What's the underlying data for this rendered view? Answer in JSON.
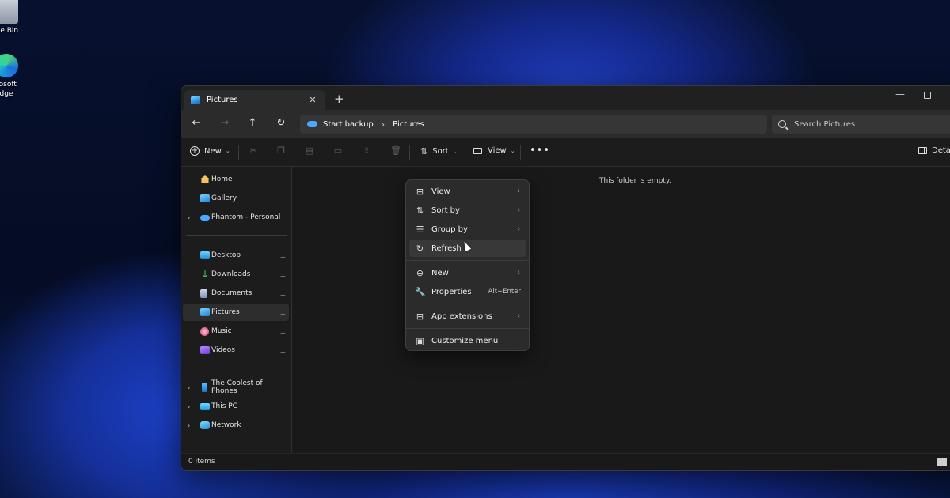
{
  "desktop": {
    "icons": [
      {
        "label": "cle Bin",
        "icon": "recycle-bin-icon"
      },
      {
        "label1": "rosoft",
        "label2": "dge",
        "icon": "edge-icon"
      }
    ]
  },
  "window": {
    "tab": {
      "title": "Pictures",
      "icon": "pictures-folder-icon",
      "close": "✕"
    },
    "new_tab": "+",
    "controls": {
      "minimize": "—"
    }
  },
  "address": {
    "back": "←",
    "forward": "→",
    "up": "↑",
    "refresh": "↻",
    "breadcrumbs": [
      "Start backup",
      "Pictures"
    ],
    "separator": "›"
  },
  "search": {
    "placeholder": "Search Pictures"
  },
  "commands": {
    "new_label": "New",
    "sort_label": "Sort",
    "view_label": "View",
    "more": "•••",
    "details_label": "Details",
    "chevron": "⌄"
  },
  "nav": {
    "items": [
      {
        "label": "Home",
        "icon": "home-icon"
      },
      {
        "label": "Gallery",
        "icon": "gallery-icon"
      },
      {
        "label": "Phantom - Personal",
        "icon": "onedrive-icon"
      },
      {
        "label": "Desktop",
        "icon": "desktop-folder-icon"
      },
      {
        "label": "Downloads",
        "icon": "downloads-folder-icon"
      },
      {
        "label": "Documents",
        "icon": "documents-folder-icon"
      },
      {
        "label": "Pictures",
        "icon": "pictures-folder-icon"
      },
      {
        "label": "Music",
        "icon": "music-folder-icon"
      },
      {
        "label": "Videos",
        "icon": "videos-folder-icon"
      },
      {
        "label": "The Coolest of Phones",
        "icon": "phone-icon"
      },
      {
        "label": "This PC",
        "icon": "this-pc-icon"
      },
      {
        "label": "Network",
        "icon": "network-icon"
      }
    ],
    "expand": "›",
    "pin": "📌"
  },
  "content": {
    "empty_message": "This folder is empty."
  },
  "status": {
    "item_count": "0 items"
  },
  "context_menu": {
    "items": [
      {
        "label": "View",
        "icon": "grid-icon",
        "glyph": "⊞"
      },
      {
        "label": "Sort by",
        "icon": "sort-icon",
        "glyph": "⇅"
      },
      {
        "label": "Group by",
        "icon": "group-icon",
        "glyph": "☰"
      },
      {
        "label": "Refresh",
        "icon": "refresh-icon",
        "glyph": "↻"
      },
      {
        "label": "New",
        "icon": "new-icon",
        "glyph": "⊕"
      },
      {
        "label": "Properties",
        "icon": "wrench-icon",
        "glyph": "🔧",
        "shortcut": "Alt+Enter"
      },
      {
        "label": "App extensions",
        "icon": "extensions-icon",
        "glyph": "⊞"
      },
      {
        "label": "Customize menu",
        "icon": "customize-icon",
        "glyph": "▣"
      }
    ],
    "arrow": "›"
  },
  "colors": {
    "accent": "#4aa8ff",
    "window_bg": "#1c1c1c",
    "menu_bg": "#2b2b2b"
  }
}
